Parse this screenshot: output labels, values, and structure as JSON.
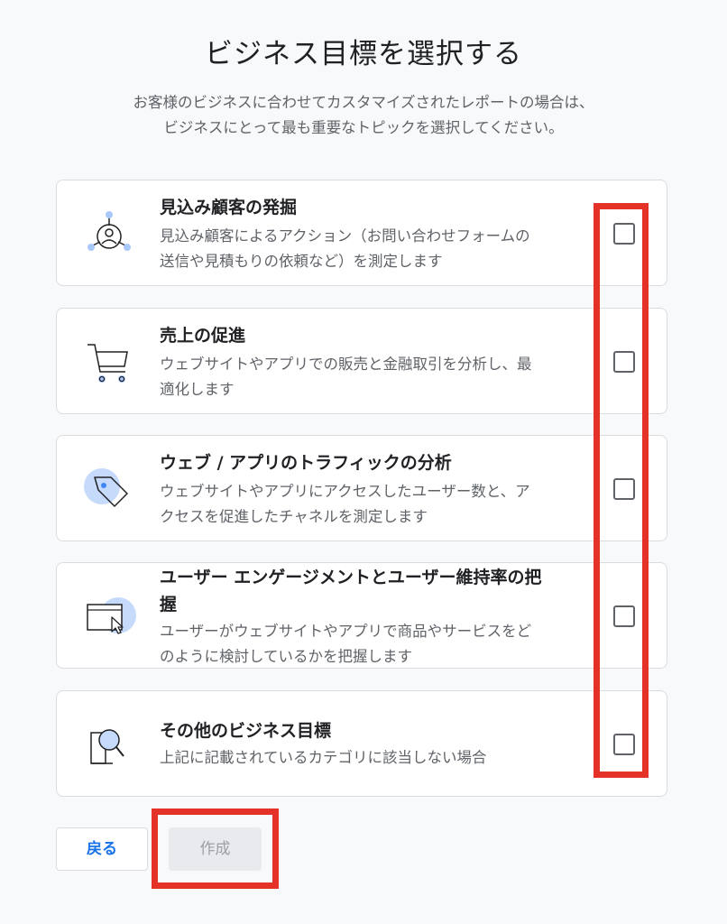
{
  "page": {
    "title": "ビジネス目標を選択する",
    "subtitle_line1": "お客様のビジネスに合わせてカスタマイズされたレポートの場合は、",
    "subtitle_line2": "ビジネスにとって最も重要なトピックを選択してください。"
  },
  "options": [
    {
      "title": "見込み顧客の発掘",
      "desc_line1": "見込み顧客によるアクション（お問い合わせフォームの",
      "desc_line2": "送信や見積もりの依頼など）を測定します",
      "icon": "lead-generation-icon",
      "checked": false
    },
    {
      "title": "売上の促進",
      "desc_line1": "ウェブサイトやアプリでの販売と金融取引を分析し、最",
      "desc_line2": "適化します",
      "icon": "shopping-cart-icon",
      "checked": false
    },
    {
      "title": "ウェブ / アプリのトラフィックの分析",
      "desc_line1": "ウェブサイトやアプリにアクセスしたユーザー数と、ア",
      "desc_line2": "クセスを促進したチャネルを測定します",
      "icon": "tag-icon",
      "checked": false
    },
    {
      "title_line1": "ユーザー エンゲージメントとユーザー維持率の把",
      "title_line2": "握",
      "desc_line1": "ユーザーがウェブサイトやアプリで商品やサービスをど",
      "desc_line2": "のように検討しているかを把握します",
      "icon": "browser-cursor-icon",
      "checked": false
    },
    {
      "title": "その他のビジネス目標",
      "desc_line1": "上記に記載されているカテゴリに該当しない場合",
      "icon": "magnifier-icon",
      "checked": false
    }
  ],
  "buttons": {
    "back": "戻る",
    "create": "作成"
  },
  "colors": {
    "accent": "#1a73e8",
    "icon_fill": "#c6dafc",
    "highlight": "#e53228"
  }
}
